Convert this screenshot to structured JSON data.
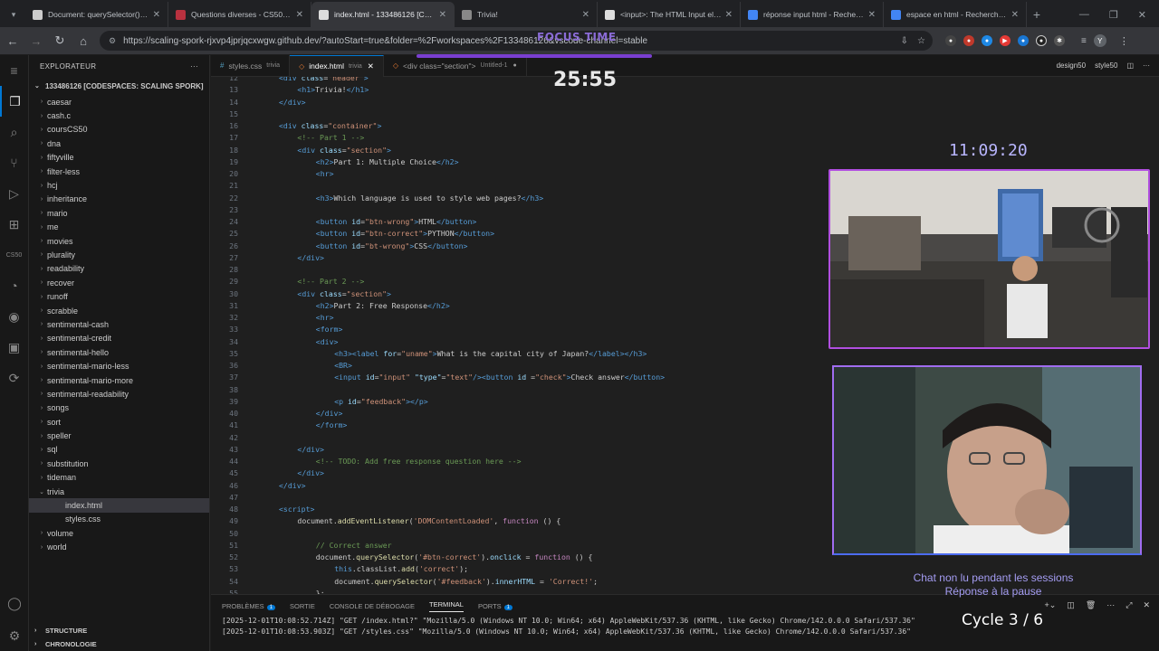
{
  "browser": {
    "tabs": [
      {
        "title": "Document: querySelector() met",
        "fav": "#ccc"
      },
      {
        "title": "Questions diverses - CS50x 20",
        "fav": "#b8313f"
      },
      {
        "title": "index.html - 133486126 [Code",
        "fav": "#ddd",
        "active": true
      },
      {
        "title": "Trivia!",
        "fav": "#888"
      },
      {
        "title": "<input>: The HTML Input elem",
        "fav": "#ddd"
      },
      {
        "title": "réponse input html - Recherche",
        "fav": "#4285f4"
      },
      {
        "title": "espace en html - Recherche Go",
        "fav": "#4285f4"
      }
    ],
    "url": "https://scaling-spork-rjxvp4jprjqcxwgw.github.dev/?autoStart=true&folder=%2Fworkspaces%2F133486126&vscode-channel=stable",
    "profile_initial": "Y"
  },
  "explorer": {
    "header": "EXPLORATEUR",
    "workspace": "133486126 [CODESPACES: SCALING SPORK]",
    "items": [
      {
        "label": "caesar",
        "type": "folder",
        "depth": 1
      },
      {
        "label": "cash.c",
        "type": "folder",
        "depth": 1
      },
      {
        "label": "coursCS50",
        "type": "folder",
        "depth": 1
      },
      {
        "label": "dna",
        "type": "folder",
        "depth": 1
      },
      {
        "label": "fiftyville",
        "type": "folder",
        "depth": 1
      },
      {
        "label": "filter-less",
        "type": "folder",
        "depth": 1
      },
      {
        "label": "hcj",
        "type": "folder",
        "depth": 1
      },
      {
        "label": "inheritance",
        "type": "folder",
        "depth": 1
      },
      {
        "label": "mario",
        "type": "folder",
        "depth": 1
      },
      {
        "label": "me",
        "type": "folder",
        "depth": 1
      },
      {
        "label": "movies",
        "type": "folder",
        "depth": 1
      },
      {
        "label": "plurality",
        "type": "folder",
        "depth": 1
      },
      {
        "label": "readability",
        "type": "folder",
        "depth": 1
      },
      {
        "label": "recover",
        "type": "folder",
        "depth": 1
      },
      {
        "label": "runoff",
        "type": "folder",
        "depth": 1
      },
      {
        "label": "scrabble",
        "type": "folder",
        "depth": 1
      },
      {
        "label": "sentimental-cash",
        "type": "folder",
        "depth": 1
      },
      {
        "label": "sentimental-credit",
        "type": "folder",
        "depth": 1
      },
      {
        "label": "sentimental-hello",
        "type": "folder",
        "depth": 1
      },
      {
        "label": "sentimental-mario-less",
        "type": "folder",
        "depth": 1
      },
      {
        "label": "sentimental-mario-more",
        "type": "folder",
        "depth": 1
      },
      {
        "label": "sentimental-readability",
        "type": "folder",
        "depth": 1
      },
      {
        "label": "songs",
        "type": "folder",
        "depth": 1
      },
      {
        "label": "sort",
        "type": "folder",
        "depth": 1
      },
      {
        "label": "speller",
        "type": "folder",
        "depth": 1
      },
      {
        "label": "sql",
        "type": "folder",
        "depth": 1
      },
      {
        "label": "substitution",
        "type": "folder",
        "depth": 1
      },
      {
        "label": "tideman",
        "type": "folder",
        "depth": 1
      },
      {
        "label": "trivia",
        "type": "open-folder",
        "depth": 1
      },
      {
        "label": "index.html",
        "type": "file",
        "depth": 2,
        "selected": true
      },
      {
        "label": "styles.css",
        "type": "file",
        "depth": 2
      },
      {
        "label": "volume",
        "type": "folder",
        "depth": 1
      },
      {
        "label": "world",
        "type": "folder",
        "depth": 1
      }
    ],
    "structure": "STRUCTURE",
    "timeline": "CHRONOLOGIE"
  },
  "editor": {
    "tabs": [
      {
        "label": "styles.css",
        "sub": "trivia"
      },
      {
        "label": "index.html",
        "sub": "trivia",
        "active": true
      },
      {
        "label": "<div class=\"section\">",
        "sub": "Untitled-1"
      }
    ],
    "tools": [
      "design50",
      "style50"
    ],
    "lines": [
      {
        "n": "12",
        "html": "<span class='tg'>&lt;div</span> <span class='at'>class</span>=<span class='st'>\"header\"</span><span class='tg'>&gt;</span>",
        "indent": 0
      },
      {
        "n": "13",
        "html": "<span class='tg'>&lt;h1&gt;</span>Trivia!<span class='tg'>&lt;/h1&gt;</span>",
        "indent": 2
      },
      {
        "n": "14",
        "html": "<span class='tg'>&lt;/div&gt;</span>",
        "indent": 0
      },
      {
        "n": "15",
        "html": "",
        "indent": 0
      },
      {
        "n": "16",
        "html": "<span class='tg'>&lt;div</span> <span class='at'>class</span>=<span class='st'>\"container\"</span><span class='tg'>&gt;</span>",
        "indent": 0
      },
      {
        "n": "17",
        "html": "<span class='cm'>&lt;!-- Part 1 --&gt;</span>",
        "indent": 2
      },
      {
        "n": "18",
        "html": "<span class='tg'>&lt;div</span> <span class='at'>class</span>=<span class='st'>\"section\"</span><span class='tg'>&gt;</span>",
        "indent": 2
      },
      {
        "n": "19",
        "html": "<span class='tg'>&lt;h2&gt;</span>Part 1: Multiple Choice<span class='tg'>&lt;/h2&gt;</span>",
        "indent": 4
      },
      {
        "n": "20",
        "html": "<span class='tg'>&lt;hr&gt;</span>",
        "indent": 4
      },
      {
        "n": "21",
        "html": "",
        "indent": 0
      },
      {
        "n": "22",
        "html": "<span class='tg'>&lt;h3&gt;</span>Which language is used to style web pages?<span class='tg'>&lt;/h3&gt;</span>",
        "indent": 4
      },
      {
        "n": "23",
        "html": "",
        "indent": 0
      },
      {
        "n": "24",
        "html": "<span class='tg'>&lt;button</span> <span class='at'>id</span>=<span class='st'>\"btn-wrong\"</span><span class='tg'>&gt;</span>HTML<span class='tg'>&lt;/button&gt;</span>",
        "indent": 4
      },
      {
        "n": "25",
        "html": "<span class='tg'>&lt;button</span> <span class='at'>id</span>=<span class='st'>\"btn-correct\"</span><span class='tg'>&gt;</span>PYTHON<span class='tg'>&lt;/button&gt;</span>",
        "indent": 4
      },
      {
        "n": "26",
        "html": "<span class='tg'>&lt;button</span> <span class='at'>id</span>=<span class='st'>\"bt-wrong\"</span><span class='tg'>&gt;</span>CSS<span class='tg'>&lt;/button&gt;</span>",
        "indent": 4
      },
      {
        "n": "27",
        "html": "<span class='tg'>&lt;/div&gt;</span>",
        "indent": 2
      },
      {
        "n": "28",
        "html": "",
        "indent": 0
      },
      {
        "n": "29",
        "html": "<span class='cm'>&lt;!-- Part 2 --&gt;</span>",
        "indent": 2
      },
      {
        "n": "30",
        "html": "<span class='tg'>&lt;div</span> <span class='at'>class</span>=<span class='st'>\"section\"</span><span class='tg'>&gt;</span>",
        "indent": 2
      },
      {
        "n": "31",
        "html": "<span class='tg'>&lt;h2&gt;</span>Part 2: Free Response<span class='tg'>&lt;/h2&gt;</span>",
        "indent": 4
      },
      {
        "n": "32",
        "html": "<span class='tg'>&lt;hr&gt;</span>",
        "indent": 4
      },
      {
        "n": "33",
        "html": "<span class='tg'>&lt;form&gt;</span>",
        "indent": 4
      },
      {
        "n": "34",
        "html": "<span class='tg'>&lt;div&gt;</span>",
        "indent": 4
      },
      {
        "n": "35",
        "html": "<span class='tg'>&lt;h3&gt;&lt;label</span> <span class='at'>for</span>=<span class='st'>\"uname\"</span><span class='tg'>&gt;</span>What is the capital city of Japan?<span class='tg'>&lt;/label&gt;&lt;/h3&gt;</span>",
        "indent": 6
      },
      {
        "n": "36",
        "html": "<span class='tg'>&lt;BR&gt;</span>",
        "indent": 6
      },
      {
        "n": "37",
        "html": "<span class='tg'>&lt;input</span> <span class='at'>id</span>=<span class='st'>\"input\"</span> <span class='at'>\"type\"</span>=<span class='st'>\"text\"</span><span class='tg'>/&gt;&lt;button</span> <span class='at'>id</span> =<span class='st'>\"check\"</span><span class='tg'>&gt;</span>Check answer<span class='tg'>&lt;/button&gt;</span>",
        "indent": 6
      },
      {
        "n": "38",
        "html": "",
        "indent": 0
      },
      {
        "n": "39",
        "html": "<span class='tg'>&lt;p</span> <span class='at'>id</span>=<span class='st'>\"feedback\"</span><span class='tg'>&gt;&lt;/p&gt;</span>",
        "indent": 6
      },
      {
        "n": "40",
        "html": "<span class='tg'>&lt;/div&gt;</span>",
        "indent": 4
      },
      {
        "n": "41",
        "html": "<span class='tg'>&lt;/form&gt;</span>",
        "indent": 4
      },
      {
        "n": "42",
        "html": "",
        "indent": 0
      },
      {
        "n": "43",
        "html": "<span class='tg'>&lt;/div&gt;</span>",
        "indent": 2
      },
      {
        "n": "44",
        "html": "<span class='cm'>&lt;!-- TODO: Add free response question here --&gt;</span>",
        "indent": 4
      },
      {
        "n": "45",
        "html": "<span class='tg'>&lt;/div&gt;</span>",
        "indent": 2
      },
      {
        "n": "46",
        "html": "<span class='tg'>&lt;/div&gt;</span>",
        "indent": 0
      },
      {
        "n": "47",
        "html": "",
        "indent": 0
      },
      {
        "n": "48",
        "html": "<span class='tg'>&lt;script&gt;</span>",
        "indent": 0
      },
      {
        "n": "49",
        "html": "document.<span class='fn'>addEventListener</span>(<span class='st'>'DOMContentLoaded'</span>, <span class='kw'>function</span> () {",
        "indent": 2
      },
      {
        "n": "50",
        "html": "",
        "indent": 0
      },
      {
        "n": "51",
        "html": "<span class='cm'>// Correct answer</span>",
        "indent": 4
      },
      {
        "n": "52",
        "html": "document.<span class='fn'>querySelector</span>(<span class='st'>'#btn-correct'</span>).<span class='at'>onclick</span> = <span class='kw'>function</span> () {",
        "indent": 4
      },
      {
        "n": "53",
        "html": "<span class='tg'>this</span>.classList.<span class='fn'>add</span>(<span class='st'>'correct'</span>);",
        "indent": 6
      },
      {
        "n": "54",
        "html": "document.<span class='fn'>querySelector</span>(<span class='st'>'#feedback'</span>).<span class='at'>innerHTML</span> = <span class='st'>'Correct!'</span>;",
        "indent": 6
      },
      {
        "n": "55",
        "html": "};",
        "indent": 4
      }
    ]
  },
  "panel": {
    "tabs": [
      {
        "label": "PROBLÈMES",
        "badge": "1"
      },
      {
        "label": "SORTIE"
      },
      {
        "label": "CONSOLE DE DÉBOGAGE"
      },
      {
        "label": "TERMINAL",
        "active": true
      },
      {
        "label": "PORTS",
        "badge": "1"
      }
    ],
    "terminal": [
      "[2025-12-01T10:08:52.714Z] \"GET /index.html?\" \"Mozilla/5.0 (Windows NT 10.0; Win64; x64) AppleWebKit/537.36 (KHTML, like Gecko) Chrome/142.0.0.0 Safari/537.36\"",
      "[2025-12-01T10:08:53.903Z] \"GET /styles.css\" \"Mozilla/5.0 (Windows NT 10.0; Win64; x64) AppleWebKit/537.36 (KHTML, like Gecko) Chrome/142.0.0.0 Safari/537.36\""
    ]
  },
  "overlay": {
    "focus_label": "FOCUS TIME",
    "timer": "25:55",
    "clock": "11:09:20",
    "chat_line1": "Chat non lu pendant les sessions",
    "chat_line2": "Réponse à la pause",
    "cycle": "Cycle 3 / 6"
  }
}
